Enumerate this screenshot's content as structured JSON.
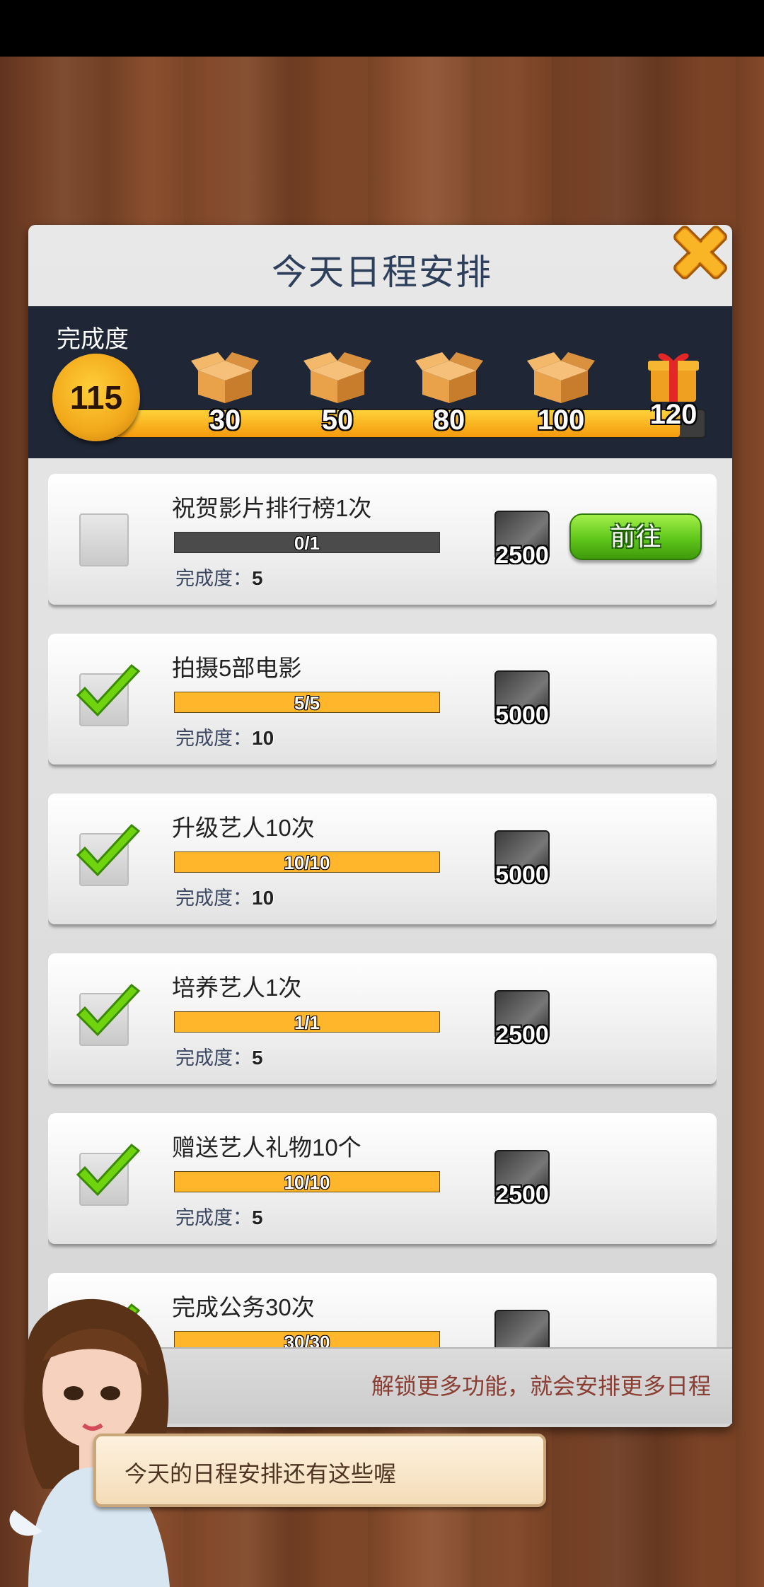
{
  "panel": {
    "title": "今天日程安排"
  },
  "progress": {
    "label": "完成度",
    "current": "115",
    "fill_fraction": 0.958,
    "milestones": [
      {
        "value": "30",
        "reward": "box-icon"
      },
      {
        "value": "50",
        "reward": "box-icon"
      },
      {
        "value": "80",
        "reward": "box-icon"
      },
      {
        "value": "100",
        "reward": "box-icon"
      },
      {
        "value": "120",
        "reward": "gift-icon"
      }
    ]
  },
  "tasks": [
    {
      "title": "祝贺影片排行榜1次",
      "progress": "0/1",
      "completed": false,
      "points_label": "完成度：",
      "points": "5",
      "reward": "2500",
      "action": "前往"
    },
    {
      "title": "拍摄5部电影",
      "progress": "5/5",
      "completed": true,
      "points_label": "完成度：",
      "points": "10",
      "reward": "5000"
    },
    {
      "title": "升级艺人10次",
      "progress": "10/10",
      "completed": true,
      "points_label": "完成度：",
      "points": "10",
      "reward": "5000"
    },
    {
      "title": "培养艺人1次",
      "progress": "1/1",
      "completed": true,
      "points_label": "完成度：",
      "points": "5",
      "reward": "2500"
    },
    {
      "title": "赠送艺人礼物10个",
      "progress": "10/10",
      "completed": true,
      "points_label": "完成度：",
      "points": "5",
      "reward": "2500"
    },
    {
      "title": "完成公务30次",
      "progress": "30/30",
      "completed": true,
      "points_label": "完成度：",
      "points": "",
      "reward": ""
    }
  ],
  "footer": {
    "text": "解锁更多功能，就会安排更多日程"
  },
  "bubble": {
    "text": "今天的日程安排还有这些喔"
  },
  "colors": {
    "title": "#2e3f5c",
    "progress_fill": "#ffb62a",
    "go_button": "#5fc61a",
    "footer_text": "#8a3d32",
    "close": "#f6a21a"
  }
}
